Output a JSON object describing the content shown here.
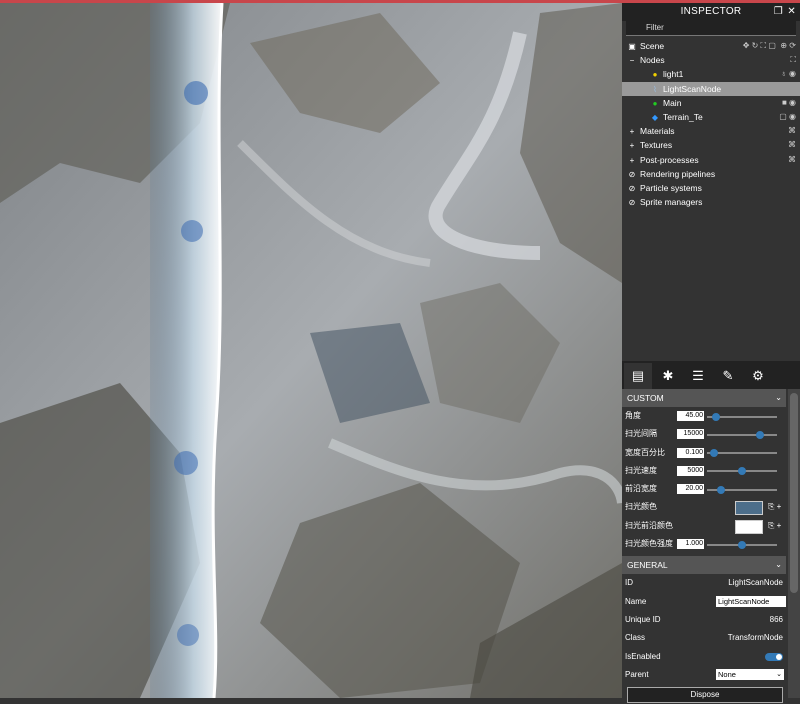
{
  "inspector": {
    "title": "INSPECTOR",
    "filter_placeholder": "Filter",
    "tree": [
      {
        "label": "Scene",
        "icon": "image-icon",
        "indent": 0
      },
      {
        "label": "Nodes",
        "icon": "collapse-icon",
        "indent": 0
      },
      {
        "label": "light1",
        "icon": "bulb-icon",
        "indent": 2
      },
      {
        "label": "LightScanNode",
        "icon": "mesh-icon",
        "indent": 2,
        "selected": true
      },
      {
        "label": "Main",
        "icon": "camera-node-icon",
        "indent": 2
      },
      {
        "label": "Terrain_Te",
        "icon": "cube-icon",
        "indent": 2
      },
      {
        "label": "Materials",
        "icon": "expand-icon",
        "indent": 0
      },
      {
        "label": "Textures",
        "icon": "expand-icon",
        "indent": 0
      },
      {
        "label": "Post-processes",
        "icon": "expand-icon",
        "indent": 0
      },
      {
        "label": "Rendering pipelines",
        "icon": "ban-icon",
        "indent": 0
      },
      {
        "label": "Particle systems",
        "icon": "ban-icon",
        "indent": 0
      },
      {
        "label": "Sprite managers",
        "icon": "ban-icon",
        "indent": 0
      }
    ],
    "tabs": [
      "file-icon",
      "bug-icon",
      "stats-icon",
      "wrench-icon",
      "gear-icon"
    ],
    "custom": {
      "title": "CUSTOM",
      "rows": [
        {
          "label": "角度",
          "value": "45.00",
          "level": 0.13
        },
        {
          "label": "扫光间隔",
          "value": "15000",
          "level": 0.75
        },
        {
          "label": "宽度百分比",
          "value": "0.100",
          "level": 0.1
        },
        {
          "label": "扫光速度",
          "value": "5000",
          "level": 0.5
        },
        {
          "label": "前沿宽度",
          "value": "20.00",
          "level": 0.2
        }
      ],
      "color1_label": "扫光颜色",
      "color1": "#4d6e8a",
      "color2_label": "扫光前沿颜色",
      "color2": "#ffffff",
      "intensity_label": "扫光颜色强度",
      "intensity_value": "1.000",
      "intensity_level": 0.5
    },
    "general": {
      "title": "GENERAL",
      "id_label": "ID",
      "id_value": "LightScanNode",
      "name_label": "Name",
      "name_value": "LightScanNode",
      "uid_label": "Unique ID",
      "uid_value": "866",
      "class_label": "Class",
      "class_value": "TransformNode",
      "enabled_label": "IsEnabled",
      "parent_label": "Parent",
      "parent_value": "None",
      "dispose_label": "Dispose"
    }
  },
  "colors": {
    "accent": "#337ab7",
    "panel": "#333333",
    "topbar": "#c8464b"
  }
}
